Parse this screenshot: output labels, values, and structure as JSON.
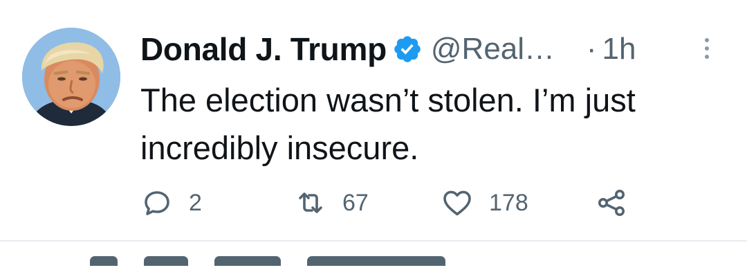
{
  "tweet": {
    "author_name": "Donald J. Trump",
    "verified_icon": "verified-badge-icon",
    "handle": "@Real…",
    "separator": "·",
    "time": "1h",
    "text": "The election wasn’t stolen. I’m just incredibly insecure.",
    "actions": {
      "reply": {
        "icon": "reply-icon",
        "count": "2"
      },
      "retweet": {
        "icon": "retweet-icon",
        "count": "67"
      },
      "like": {
        "icon": "heart-icon",
        "count": "178"
      },
      "share": {
        "icon": "share-icon"
      }
    }
  },
  "colors": {
    "text_primary": "#0f1419",
    "text_secondary": "#536471",
    "verified_blue": "#1d9bf0",
    "divider": "#e6ecf0"
  }
}
